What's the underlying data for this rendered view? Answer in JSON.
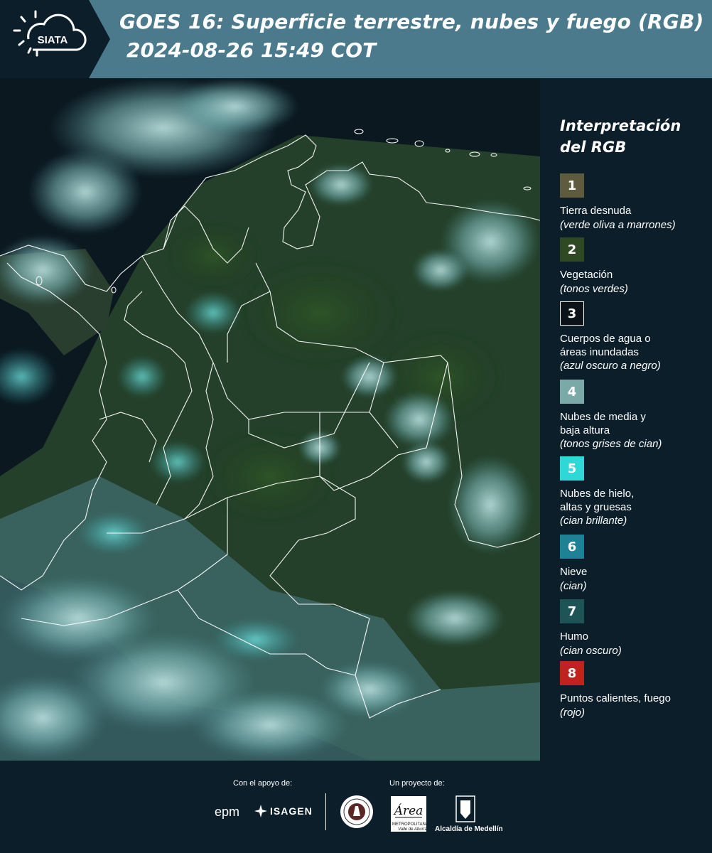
{
  "header": {
    "logo_text": "SIATA",
    "title": "GOES 16: Superficie terrestre, nubes y fuego (RGB)",
    "datetime": "2024-08-26 15:49 COT"
  },
  "legend": {
    "title": "Interpretación del RGB",
    "items": [
      {
        "num": "1",
        "label": "Tierra desnuda",
        "desc": "(verde oliva a marrones)",
        "color": "#5e5b3e"
      },
      {
        "num": "2",
        "label": "Vegetación",
        "desc": "(tonos verdes)",
        "color": "#2f4a22"
      },
      {
        "num": "3",
        "label": "Cuerpos de agua o\náreas inundadas",
        "desc": "(azul oscuro a negro)",
        "color": "#0b1318"
      },
      {
        "num": "4",
        "label": "Nubes de media y\nbaja altura",
        "desc": "(tonos grises de cian)",
        "color": "#7aa9a8"
      },
      {
        "num": "5",
        "label": "Nubes de hielo,\naltas y gruesas",
        "desc": "(cian brillante)",
        "color": "#2ed8d6"
      },
      {
        "num": "6",
        "label": "Nieve",
        "desc": "(cian)",
        "color": "#1e8196"
      },
      {
        "num": "7",
        "label": "Humo",
        "desc": "(cian oscuro)",
        "color": "#1f5456"
      },
      {
        "num": "8",
        "label": "Puntos calientes, fuego",
        "desc": "(rojo)",
        "color": "#c0221f"
      }
    ]
  },
  "footer": {
    "support_caption": "Con el apoyo de:",
    "project_caption": "Un proyecto de:",
    "supporter_1": "epm",
    "supporter_2": "ISAGEN",
    "partner_amva": "Área",
    "partner_amva_sub1": "METROPOLITANA",
    "partner_amva_sub2": "Valle de Aburrá",
    "partner_alcaldia": "Alcaldía de Medellín"
  }
}
